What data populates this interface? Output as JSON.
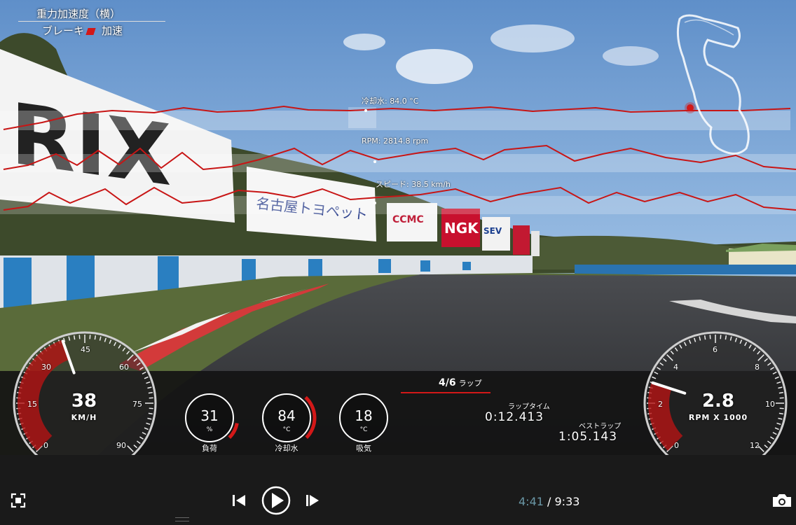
{
  "overlay": {
    "gforce_title": "重力加速度（横）",
    "brake_label": "ブレーキ",
    "accel_label": "加速"
  },
  "traces": [
    {
      "label": "冷却水: 84.0 °C"
    },
    {
      "label": "RPM: 2814.8 rpm"
    },
    {
      "label": "スピード: 38.5 km/h"
    }
  ],
  "speed_gauge": {
    "value": "38",
    "unit": "KM/H",
    "ticks": [
      "0",
      "15",
      "30",
      "45",
      "60",
      "75",
      "90"
    ],
    "max": 90,
    "reading": 38.5
  },
  "rpm_gauge": {
    "value": "2.8",
    "unit": "RPM X 1000",
    "ticks": [
      "0",
      "2",
      "4",
      "6",
      "8",
      "10",
      "12"
    ],
    "max": 12,
    "reading": 2.8
  },
  "rings": [
    {
      "value": "31",
      "unit": "%",
      "label": "負荷",
      "fraction": 0.31
    },
    {
      "value": "84",
      "unit": "°C",
      "label": "冷却水",
      "fraction": 0.84
    },
    {
      "value": "18",
      "unit": "°C",
      "label": "吸気",
      "fraction": 0
    }
  ],
  "lap": {
    "count": "4/6",
    "count_suffix": "ラップ",
    "lap_time_label": "ラップタイム",
    "lap_time": "0:12.413",
    "best_lap_label": "ベストラップ",
    "best_lap": "1:05.143"
  },
  "player": {
    "current_time": "4:41",
    "separator": " / ",
    "total_time": "9:33",
    "progress": 0.49
  },
  "colors": {
    "accent_red": "#d31818",
    "time_current": "#6a97a6"
  }
}
